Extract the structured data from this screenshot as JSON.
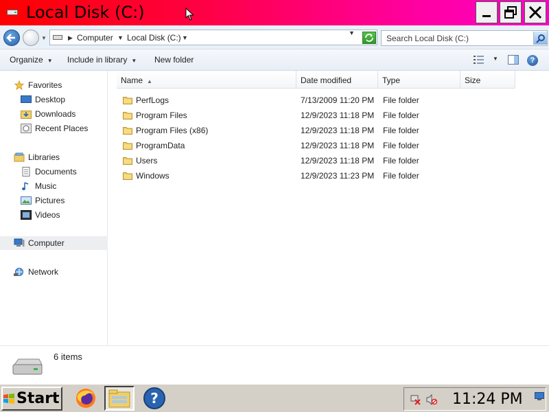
{
  "window": {
    "title": "Local Disk (C:)",
    "controls": {
      "minimize": "minimize",
      "maximize": "restore",
      "close": "close"
    }
  },
  "address": {
    "breadcrumbs": [
      "Computer",
      "Local Disk (C:)"
    ],
    "search_placeholder": "Search Local Disk (C:)"
  },
  "toolbar": {
    "organize": "Organize",
    "include_in_library": "Include in library",
    "new_folder": "New folder"
  },
  "nav": {
    "favorites": {
      "label": "Favorites",
      "items": [
        "Desktop",
        "Downloads",
        "Recent Places"
      ]
    },
    "libraries": {
      "label": "Libraries",
      "items": [
        "Documents",
        "Music",
        "Pictures",
        "Videos"
      ]
    },
    "computer": "Computer",
    "network": "Network"
  },
  "columns": [
    "Name",
    "Date modified",
    "Type",
    "Size"
  ],
  "files": [
    {
      "name": "PerfLogs",
      "date": "7/13/2009 11:20 PM",
      "type": "File folder",
      "size": ""
    },
    {
      "name": "Program Files",
      "date": "12/9/2023 11:18 PM",
      "type": "File folder",
      "size": ""
    },
    {
      "name": "Program Files (x86)",
      "date": "12/9/2023 11:18 PM",
      "type": "File folder",
      "size": ""
    },
    {
      "name": "ProgramData",
      "date": "12/9/2023 11:18 PM",
      "type": "File folder",
      "size": ""
    },
    {
      "name": "Users",
      "date": "12/9/2023 11:18 PM",
      "type": "File folder",
      "size": ""
    },
    {
      "name": "Windows",
      "date": "12/9/2023 11:23 PM",
      "type": "File folder",
      "size": ""
    }
  ],
  "details": {
    "item_count": "6 items"
  },
  "taskbar": {
    "start_label": "Start",
    "apps": [
      "firefox-icon",
      "explorer-icon",
      "help-icon"
    ],
    "clock": "11:24 PM"
  },
  "colors": {
    "titlebar_start": "#ff0000",
    "titlebar_end": "#ff00c8",
    "taskbar": "#d4d0c8",
    "selection": "#eceef0"
  }
}
